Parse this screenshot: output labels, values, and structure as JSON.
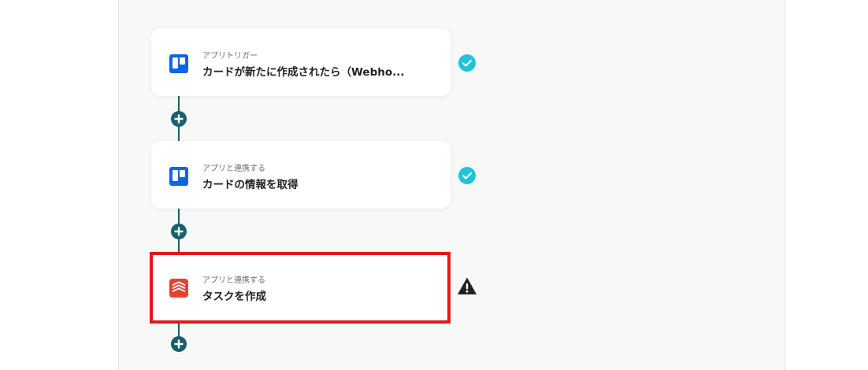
{
  "colors": {
    "connector": "#1a5f6e",
    "check_badge": "#21c3d6",
    "warning": "#222222",
    "highlight_border": "#e5161a",
    "trello_blue": "#0c66e4",
    "todoist_red": "#e44332"
  },
  "flow": {
    "steps": [
      {
        "subtitle": "アプリトリガー",
        "title": "カードが新たに作成されたら（Webho...",
        "app_icon": "trello-icon",
        "status": "check-icon"
      },
      {
        "subtitle": "アプリと連携する",
        "title": "カードの情報を取得",
        "app_icon": "trello-icon",
        "status": "check-icon"
      },
      {
        "subtitle": "アプリと連携する",
        "title": "タスクを作成",
        "app_icon": "todoist-icon",
        "status": "warning-icon",
        "highlighted": true
      }
    ],
    "add_button_icon": "plus-icon"
  }
}
